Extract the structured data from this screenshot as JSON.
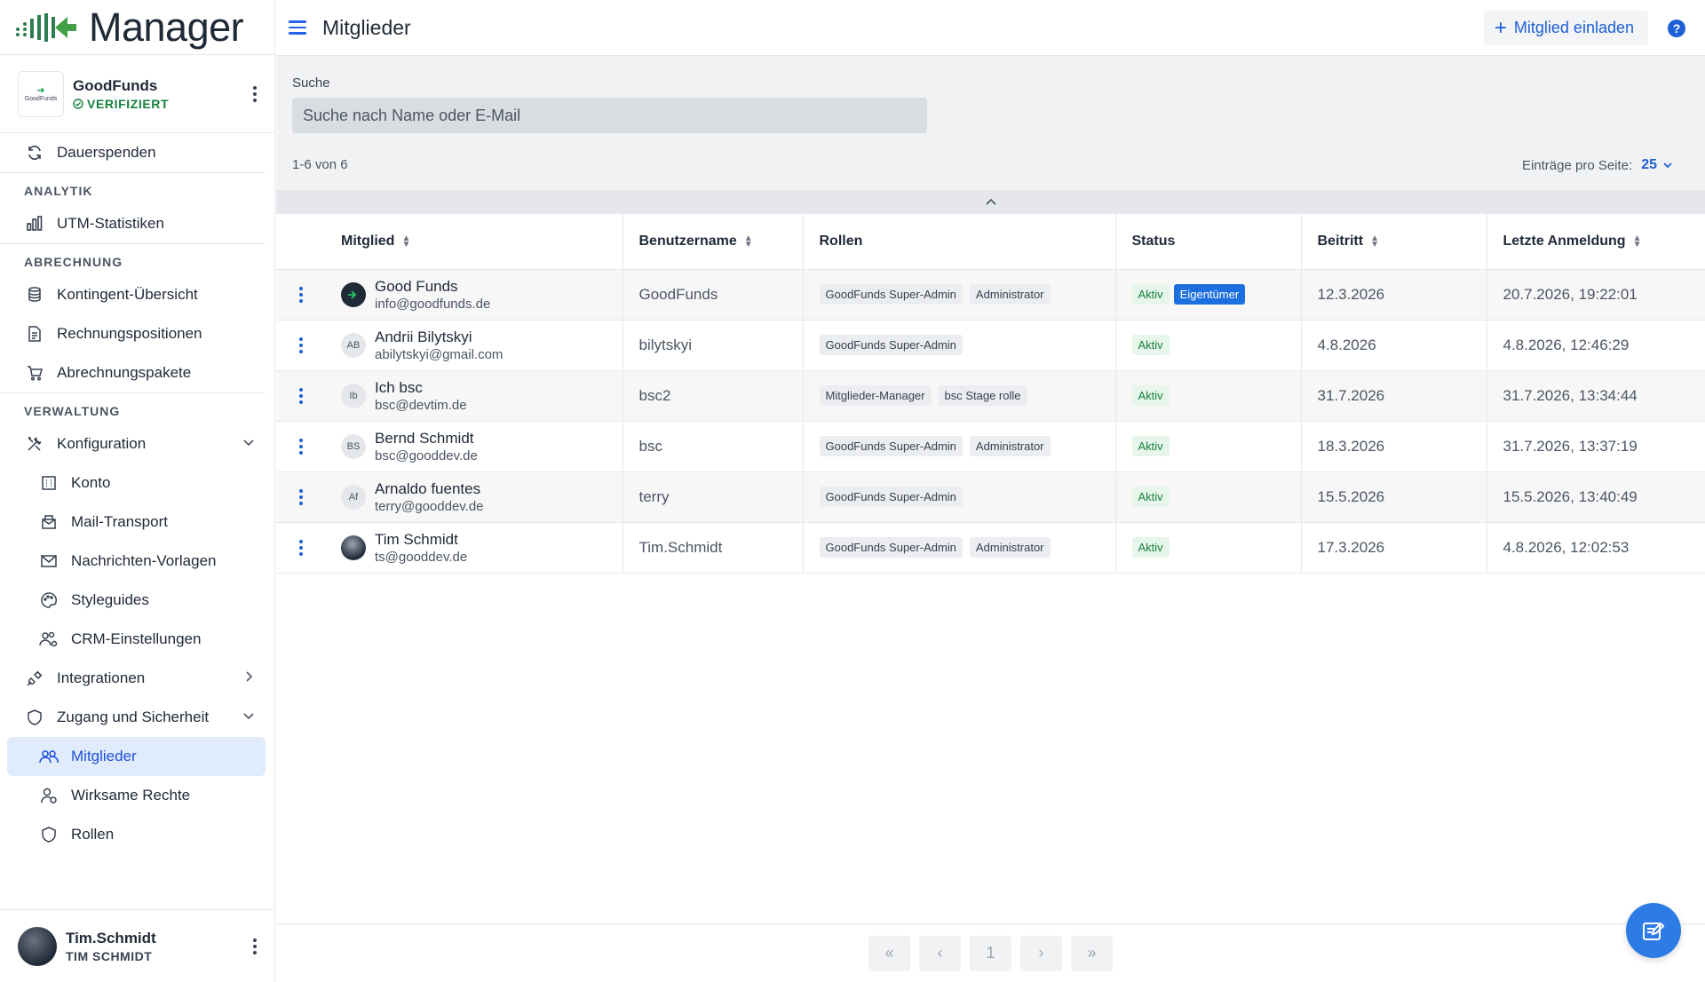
{
  "app": {
    "logo_text": "Manager"
  },
  "org": {
    "name": "GoodFunds",
    "logo_text": "GoodFunds",
    "verified": "VERIFIZIERT"
  },
  "sidebar": {
    "items_top": [
      {
        "label": "Dauerspenden",
        "icon": "refresh-icon"
      }
    ],
    "sections": [
      {
        "label": "ANALYTIK",
        "items": [
          {
            "label": "UTM-Statistiken",
            "icon": "bar-chart-icon"
          }
        ]
      },
      {
        "label": "ABRECHNUNG",
        "items": [
          {
            "label": "Kontingent-Übersicht",
            "icon": "coins-icon"
          },
          {
            "label": "Rechnungspositionen",
            "icon": "invoice-icon"
          },
          {
            "label": "Abrechnungspakete",
            "icon": "cart-icon"
          }
        ]
      },
      {
        "label": "VERWALTUNG",
        "items": [
          {
            "label": "Konfiguration",
            "icon": "tools-icon"
          },
          {
            "label": "Konto",
            "icon": "building-icon"
          },
          {
            "label": "Mail-Transport",
            "icon": "mailbox-icon"
          },
          {
            "label": "Nachrichten-Vorlagen",
            "icon": "envelope-icon"
          },
          {
            "label": "Styleguides",
            "icon": "palette-icon"
          },
          {
            "label": "CRM-Einstellungen",
            "icon": "users-gear-icon"
          },
          {
            "label": "Integrationen",
            "icon": "plug-icon"
          },
          {
            "label": "Zugang und Sicherheit",
            "icon": "shield-icon"
          },
          {
            "label": "Mitglieder",
            "icon": "users-icon"
          },
          {
            "label": "Wirksame Rechte",
            "icon": "user-check-icon"
          },
          {
            "label": "Rollen",
            "icon": "shield-icon"
          }
        ]
      }
    ]
  },
  "user": {
    "name": "Tim.Schmidt",
    "sub": "TIM SCHMIDT"
  },
  "header": {
    "title": "Mitglieder",
    "invite_label": "Mitglied einladen",
    "help": "?"
  },
  "search": {
    "label": "Suche",
    "placeholder": "Suche nach Name oder E-Mail",
    "value": ""
  },
  "pager_info": {
    "range": "1-6 von 6",
    "per_page_label": "Einträge pro Seite:",
    "per_page_value": "25"
  },
  "table": {
    "columns": [
      "Mitglied",
      "Benutzername",
      "Rollen",
      "Status",
      "Beitritt",
      "Letzte Anmeldung"
    ],
    "rows": [
      {
        "name": "Good Funds",
        "email": "info@goodfunds.de",
        "avatar": "",
        "username": "GoodFunds",
        "roles": [
          "GoodFunds Super-Admin",
          "Administrator"
        ],
        "status": "Aktiv",
        "owner": "Eigentümer",
        "joined": "12.3.2026",
        "last_login": "20.7.2026, 19:22:01"
      },
      {
        "name": "Andrii Bilytskyi",
        "email": "abilytskyi@gmail.com",
        "avatar": "AB",
        "username": "bilytskyi",
        "roles": [
          "GoodFunds Super-Admin"
        ],
        "status": "Aktiv",
        "owner": "",
        "joined": "4.8.2026",
        "last_login": "4.8.2026, 12:46:29"
      },
      {
        "name": "Ich bsc",
        "email": "bsc@devtim.de",
        "avatar": "Ib",
        "username": "bsc2",
        "roles": [
          "Mitglieder-Manager",
          "bsc Stage rolle"
        ],
        "status": "Aktiv",
        "owner": "",
        "joined": "31.7.2026",
        "last_login": "31.7.2026, 13:34:44"
      },
      {
        "name": "Bernd Schmidt",
        "email": "bsc@gooddev.de",
        "avatar": "BS",
        "username": "bsc",
        "roles": [
          "GoodFunds Super-Admin",
          "Administrator"
        ],
        "status": "Aktiv",
        "owner": "",
        "joined": "18.3.2026",
        "last_login": "31.7.2026, 13:37:19"
      },
      {
        "name": "Arnaldo fuentes",
        "email": "terry@gooddev.de",
        "avatar": "Af",
        "username": "terry",
        "roles": [
          "GoodFunds Super-Admin"
        ],
        "status": "Aktiv",
        "owner": "",
        "joined": "15.5.2026",
        "last_login": "15.5.2026, 13:40:49"
      },
      {
        "name": "Tim Schmidt",
        "email": "ts@gooddev.de",
        "avatar": "",
        "username": "Tim.Schmidt",
        "roles": [
          "GoodFunds Super-Admin",
          "Administrator"
        ],
        "status": "Aktiv",
        "owner": "",
        "joined": "17.3.2026",
        "last_login": "4.8.2026, 12:02:53"
      }
    ]
  },
  "pagination": {
    "current": "1"
  },
  "colors": {
    "accent": "#1d5fd6",
    "active_bg": "#e0ecfb",
    "status_green": "#15803d",
    "owner_blue": "#1d6fe0"
  }
}
